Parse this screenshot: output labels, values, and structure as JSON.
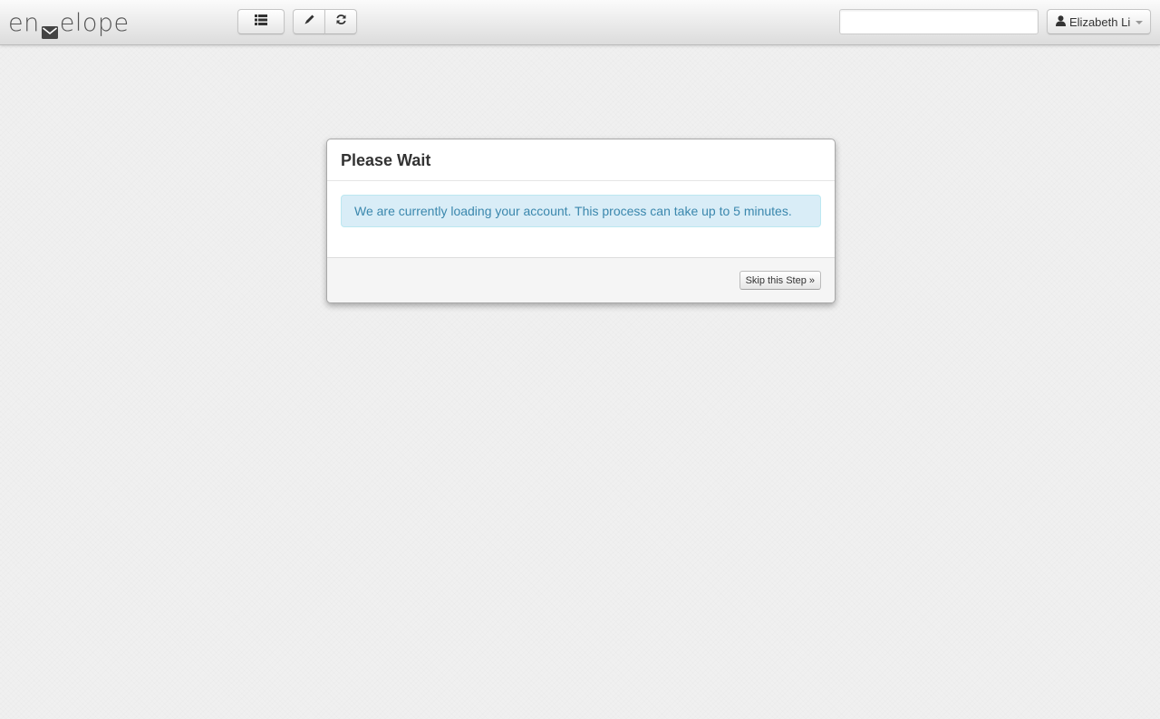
{
  "app": {
    "brand_before": "en",
    "brand_after": "elope",
    "icons": {
      "brand": "envelope-icon",
      "list": "list-icon",
      "compose": "pencil-icon",
      "refresh": "refresh-icon",
      "user": "user-icon"
    }
  },
  "header": {
    "search": {
      "value": "",
      "placeholder": ""
    },
    "user_name": "Elizabeth Li"
  },
  "modal": {
    "title": "Please Wait",
    "message": "We are currently loading your account. This process can take up to 5 minutes.",
    "skip_label": "Skip this Step »"
  },
  "colors": {
    "alert_bg": "#d9edf7",
    "alert_text": "#3a87ad"
  }
}
